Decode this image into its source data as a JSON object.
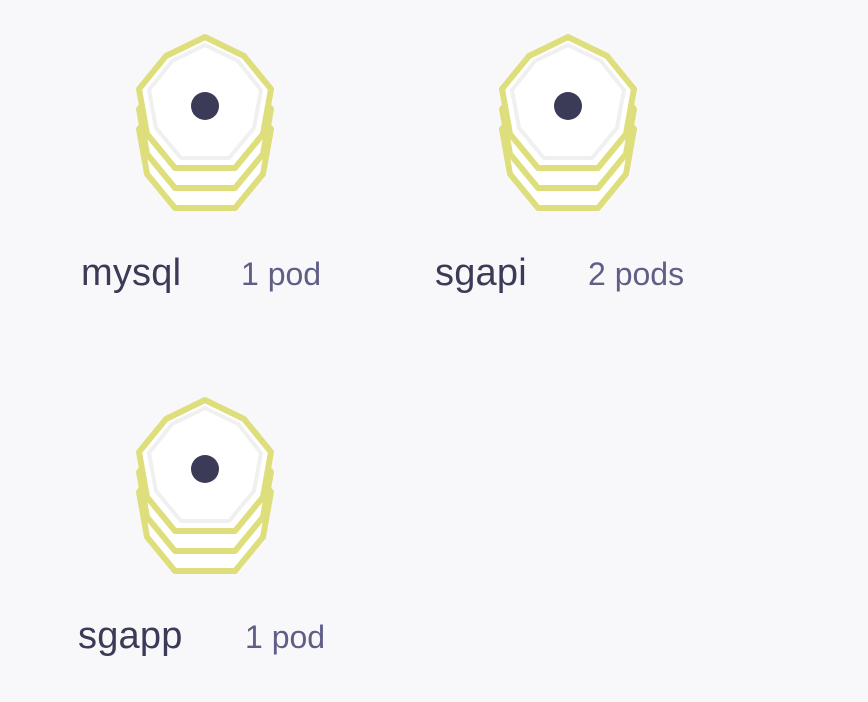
{
  "graph": {
    "colors": {
      "background": "#f8f8fa",
      "hex_stroke": "#dede7c",
      "hex_fill": "#ffffff",
      "dot": "#3b3a57",
      "label": "#3b3a57",
      "count": "#5f5e86"
    },
    "nodes": [
      {
        "name": "mysql",
        "pods": "1 pod",
        "icon": "service-stack-icon"
      },
      {
        "name": "sgapi",
        "pods": "2 pods",
        "icon": "service-stack-icon"
      },
      {
        "name": "sgapp",
        "pods": "1 pod",
        "icon": "service-stack-icon"
      }
    ]
  }
}
